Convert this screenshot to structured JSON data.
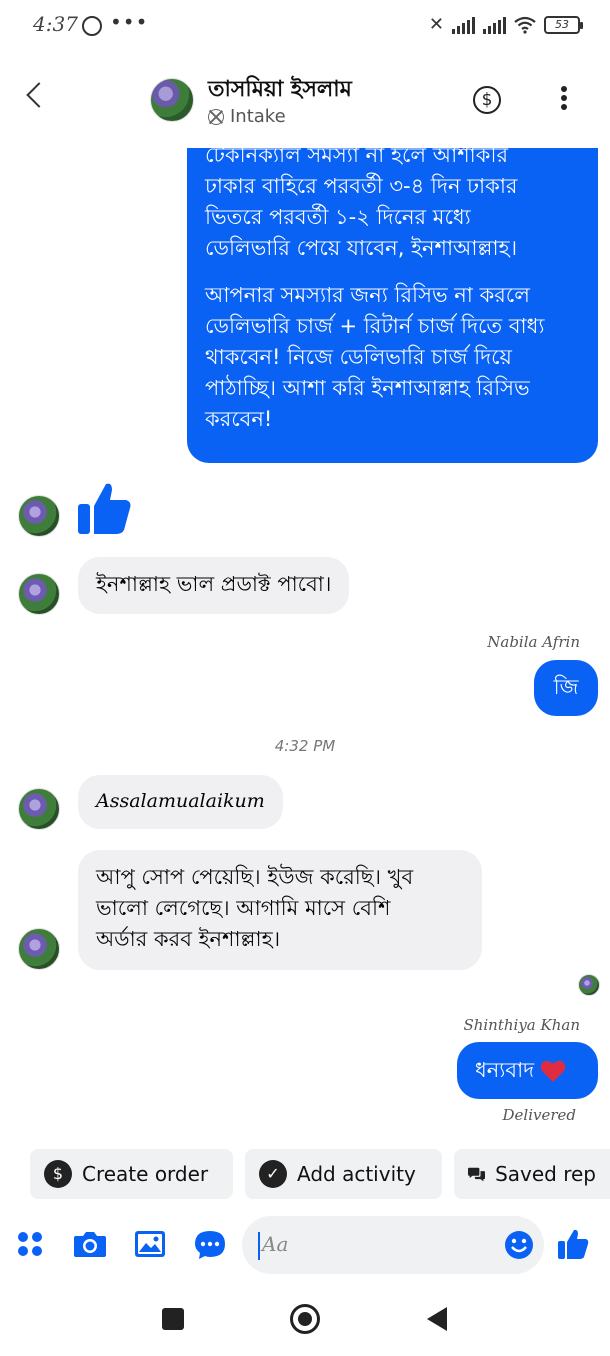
{
  "status": {
    "time": "4:37",
    "battery": "53"
  },
  "header": {
    "name": "তাসমিয়া ইসলাম",
    "subtitle": "Intake"
  },
  "messages": {
    "m1_lines": [
      "টেকনিক্যাল সমস্যা না হলে আশাকরি",
      "ঢাকার বাহিরে পরবর্তী  ৩-৪ দিন  ঢাকার",
      "ভিতরে পরবর্তী ১-২ দিনের মধ্যে",
      "ডেলিভারি পেয়ে যাবেন, ইনশাআল্লাহ।",
      "",
      "আপনার সমস্যার জন্য রিসিভ না করলে",
      "ডেলিভারি চার্জ + রিটার্ন চার্জ দিতে বাধ্য",
      "থাকবেন!  নিজে ডেলিভারি চার্জ দিয়ে",
      "পাঠাচ্ছি। আশা করি ইনশাআল্লাহ রিসিভ",
      "করবেন!"
    ],
    "m3": "ইনশাল্লাহ ভাল প্রডাক্ট পাবো।",
    "sender1": "Nabila Afrin",
    "m4": "জি",
    "time_sep": "4:32 PM",
    "m5": "Assalamualaikum",
    "m6_lines": [
      "আপু সোপ পেয়েছি।  ইউজ করেছি। খুব",
      "ভালো লেগেছে। আগামি মাসে বেশি",
      "অর্ডার করব ইনশাল্লাহ।"
    ],
    "sender2": "Shinthiya Khan",
    "m7": "ধন্যবাদ",
    "status": "Delivered"
  },
  "quick_actions": {
    "create_order": "Create order",
    "add_activity": "Add activity",
    "saved_replies": "Saved rep"
  },
  "composer": {
    "placeholder": "Aa"
  },
  "colors": {
    "accent": "#0a62f5",
    "bubble_gray": "#f0f0f2",
    "heart": "#e02c41"
  }
}
